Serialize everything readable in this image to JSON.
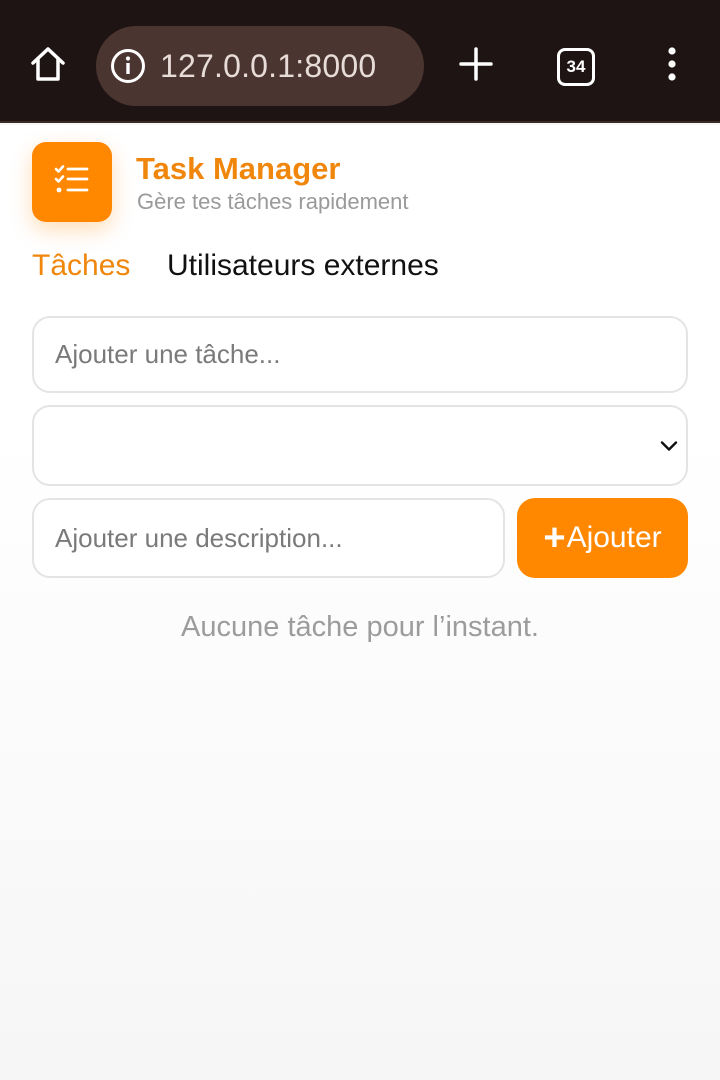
{
  "browser": {
    "url": "127.0.0.1:8000",
    "tab_count": "34",
    "icons": [
      "home-icon",
      "info-icon",
      "plus-icon",
      "tab-switcher-icon",
      "kebab-menu-icon"
    ]
  },
  "app": {
    "title": "Task Manager",
    "subtitle": "Gère tes tâches rapidement",
    "logo_icon": "checklist-icon",
    "accent_color": "#ff8800"
  },
  "nav": {
    "tasks_label": "Tâches",
    "external_users_label": "Utilisateurs externes",
    "active_tab": "Tâches"
  },
  "form": {
    "task_placeholder": "Ajouter une tâche...",
    "select_value": "",
    "description_placeholder": "Ajouter une description...",
    "add_button_label": "Ajouter",
    "add_button_icon": "plus-icon"
  },
  "empty_state": "Aucune tâche pour l’instant."
}
